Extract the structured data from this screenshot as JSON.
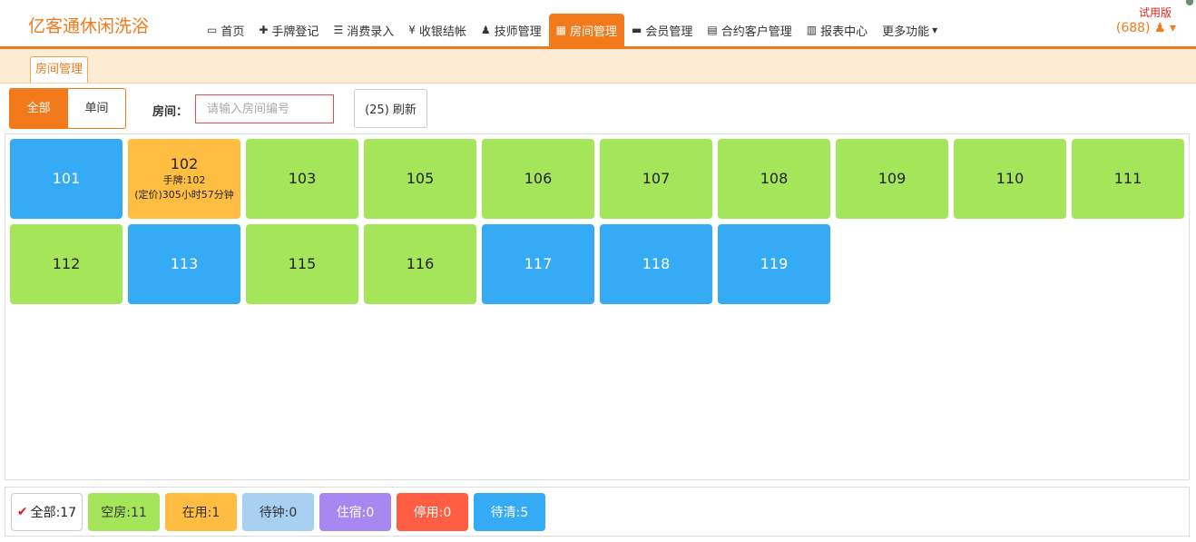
{
  "brand": "亿客通休闲洗浴",
  "nav": [
    {
      "icon": "monitor-icon",
      "glyph": "▭",
      "label": "首页"
    },
    {
      "icon": "plus-icon",
      "glyph": "✚",
      "label": "手牌登记"
    },
    {
      "icon": "list-icon",
      "glyph": "☰",
      "label": "消费录入"
    },
    {
      "icon": "yen-icon",
      "glyph": "¥",
      "label": "收银结帐"
    },
    {
      "icon": "user-icon",
      "glyph": "♟",
      "label": "技师管理"
    },
    {
      "icon": "grid-icon",
      "glyph": "▦",
      "label": "房间管理"
    },
    {
      "icon": "card-icon",
      "glyph": "▬",
      "label": "会员管理"
    },
    {
      "icon": "contract-icon",
      "glyph": "▤",
      "label": "合约客户管理"
    },
    {
      "icon": "bar-chart-icon",
      "glyph": "▥",
      "label": "报表中心"
    },
    {
      "icon": "caret-down-icon",
      "glyph": "▾",
      "label": "更多功能"
    }
  ],
  "active_nav": "房间管理",
  "trial": "试用版",
  "user": {
    "id": "(688)",
    "icon": "user-icon",
    "glyph": "♟ ▾"
  },
  "tab": "房间管理",
  "filter": {
    "all": "全部",
    "single": "单间"
  },
  "room_label": "房间：",
  "room_placeholder": "请输入房间编号",
  "refresh": "(25) 刷新",
  "colors": {
    "accent": "#f27a1a",
    "vacant": "#a5e55a",
    "in_use": "#ffbe42",
    "waiting": "#a8d0f0",
    "lodging": "#a787f0",
    "disabled": "#ff5e43",
    "to_clean": "#35aaf5"
  },
  "rooms": [
    {
      "number": "101",
      "status": "blue"
    },
    {
      "number": "102",
      "status": "orange",
      "tag": "手牌:102",
      "detail": "(定价)305小时57分钟"
    },
    {
      "number": "103",
      "status": "green"
    },
    {
      "number": "105",
      "status": "green"
    },
    {
      "number": "106",
      "status": "green"
    },
    {
      "number": "107",
      "status": "green"
    },
    {
      "number": "108",
      "status": "green"
    },
    {
      "number": "109",
      "status": "green"
    },
    {
      "number": "110",
      "status": "green"
    },
    {
      "number": "111",
      "status": "green"
    },
    {
      "number": "112",
      "status": "green"
    },
    {
      "number": "113",
      "status": "blue"
    },
    {
      "number": "115",
      "status": "green"
    },
    {
      "number": "116",
      "status": "green"
    },
    {
      "number": "117",
      "status": "blue"
    },
    {
      "number": "118",
      "status": "blue"
    },
    {
      "number": "119",
      "status": "blue"
    }
  ],
  "summary": [
    {
      "key": "all",
      "label": "全部:17",
      "check": "✔"
    },
    {
      "key": "vacant",
      "label": "空房:11"
    },
    {
      "key": "in_use",
      "label": "在用:1"
    },
    {
      "key": "waiting",
      "label": "待钟:0"
    },
    {
      "key": "lodging",
      "label": "住宿:0"
    },
    {
      "key": "disabled",
      "label": "停用:0"
    },
    {
      "key": "to_clean",
      "label": "待清:5"
    }
  ]
}
